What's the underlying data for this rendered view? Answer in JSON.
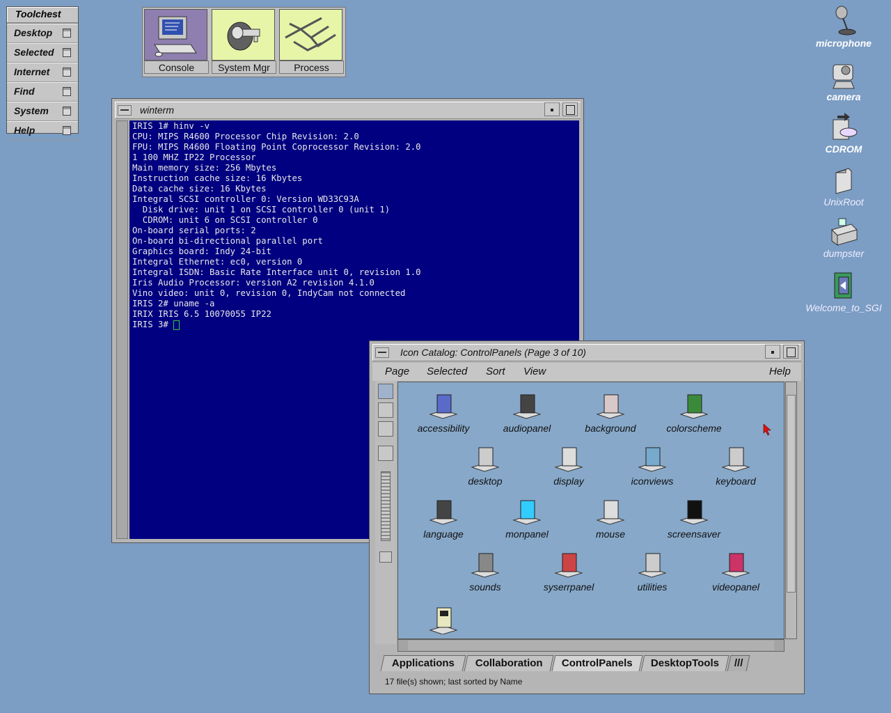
{
  "toolchest": {
    "title": "Toolchest",
    "items": [
      "Desktop",
      "Selected",
      "Internet",
      "Find",
      "System",
      "Help"
    ]
  },
  "top_icons": [
    {
      "label": "Console",
      "icon": "console-icon"
    },
    {
      "label": "System Mgr",
      "icon": "system-manager-icon"
    },
    {
      "label": "Process",
      "icon": "process-icon"
    }
  ],
  "winterm": {
    "title": "winterm",
    "lines": [
      "IRIS 1# hinv -v",
      "CPU: MIPS R4600 Processor Chip Revision: 2.0",
      "FPU: MIPS R4600 Floating Point Coprocessor Revision: 2.0",
      "1 100 MHZ IP22 Processor",
      "Main memory size: 256 Mbytes",
      "Instruction cache size: 16 Kbytes",
      "Data cache size: 16 Kbytes",
      "Integral SCSI controller 0: Version WD33C93A",
      "  Disk drive: unit 1 on SCSI controller 0 (unit 1)",
      "  CDROM: unit 6 on SCSI controller 0",
      "On-board serial ports: 2",
      "On-board bi-directional parallel port",
      "Graphics board: Indy 24-bit",
      "Integral Ethernet: ec0, version 0",
      "Integral ISDN: Basic Rate Interface unit 0, revision 1.0",
      "Iris Audio Processor: version A2 revision 4.1.0",
      "Vino video: unit 0, revision 0, IndyCam not connected",
      "IRIS 2# uname -a",
      "IRIX IRIS 6.5 10070055 IP22"
    ],
    "prompt": "IRIS 3# "
  },
  "catalog": {
    "title": "Icon Catalog: ControlPanels (Page 3 of 10)",
    "menu": [
      "Page",
      "Selected",
      "Sort",
      "View"
    ],
    "help": "Help",
    "icons": [
      "accessibility",
      "audiopanel",
      "background",
      "colorscheme",
      "desktop",
      "display",
      "iconviews",
      "keyboard",
      "language",
      "monpanel",
      "mouse",
      "screensaver",
      "sounds",
      "syserrpanel",
      "utilities",
      "videopanel"
    ],
    "tabs": [
      "Applications",
      "Collaboration",
      "ControlPanels",
      "DesktopTools"
    ],
    "active_tab": "ControlPanels",
    "status": "17 file(s) shown; last sorted by Name"
  },
  "desktop_icons": [
    {
      "label": "microphone",
      "icon": "microphone-icon"
    },
    {
      "label": "camera",
      "icon": "camera-icon"
    },
    {
      "label": "CDROM",
      "icon": "cdrom-icon"
    },
    {
      "label": "UnixRoot",
      "icon": "folder-icon"
    },
    {
      "label": "dumpster",
      "icon": "dumpster-icon"
    },
    {
      "label": "Welcome_to_SGI",
      "icon": "welcome-icon"
    }
  ],
  "colors": {
    "desktop": "#7c9dc4",
    "terminal_bg": "#000080",
    "catalog_bg": "#87a8c9"
  }
}
